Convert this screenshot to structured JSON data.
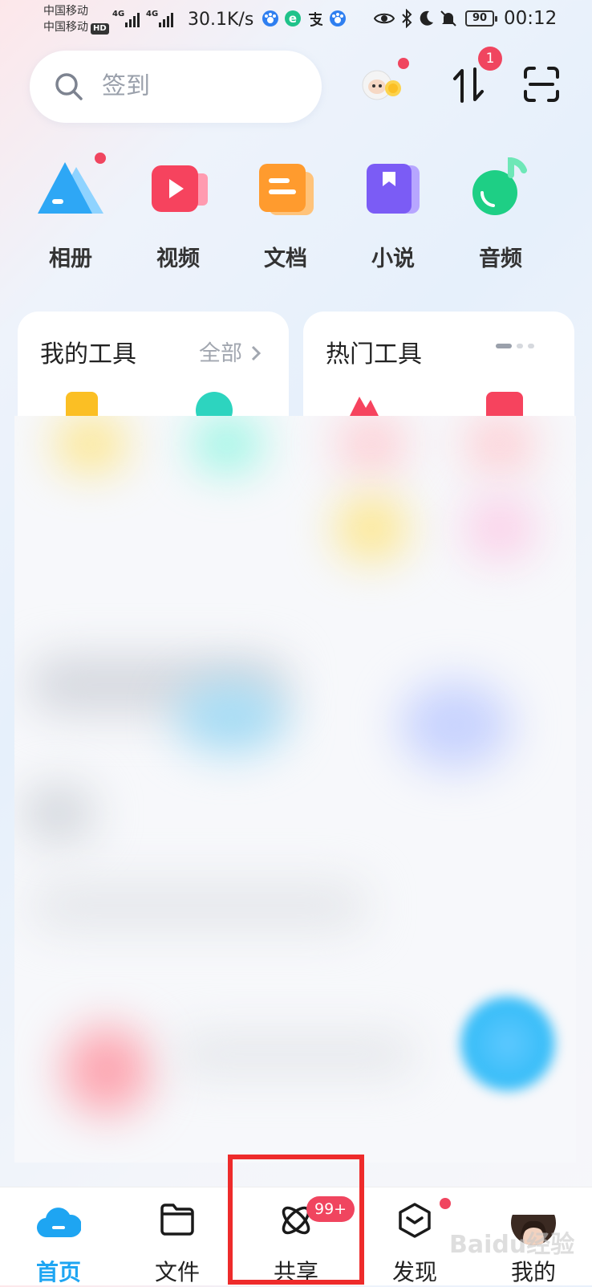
{
  "status_bar": {
    "carrier1": "中国移动",
    "carrier2": "中国移动",
    "hd_label": "HD",
    "network1": "4G",
    "network2": "4G",
    "speed": "30.1K/s",
    "battery": "90",
    "time": "00:12",
    "icons": [
      "baidu-paw-icon",
      "browser-e-icon",
      "alipay-icon",
      "baidu-paw-icon",
      "eye-icon",
      "bluetooth-icon",
      "moon-icon",
      "bell-muted-icon"
    ]
  },
  "header": {
    "search_placeholder": "签到",
    "transfer_badge": "1"
  },
  "categories": [
    {
      "label": "相册",
      "icon": "album-icon"
    },
    {
      "label": "视频",
      "icon": "video-icon"
    },
    {
      "label": "文档",
      "icon": "document-icon"
    },
    {
      "label": "小说",
      "icon": "novel-icon"
    },
    {
      "label": "音频",
      "icon": "audio-icon"
    }
  ],
  "my_tools": {
    "title": "我的工具",
    "more": "全部"
  },
  "hot_tools": {
    "title": "热门工具"
  },
  "bottom_nav": [
    {
      "label": "首页",
      "icon": "cloud-icon",
      "active": true
    },
    {
      "label": "文件",
      "icon": "folder-icon",
      "active": false
    },
    {
      "label": "共享",
      "icon": "share-orbit-icon",
      "badge": "99+",
      "active": false
    },
    {
      "label": "发现",
      "icon": "discover-cube-icon",
      "active": false
    },
    {
      "label": "我的",
      "icon": "avatar",
      "active": false
    }
  ],
  "watermark": "Baidu经验",
  "colors": {
    "accent": "#1ea5f2",
    "badge": "#f0455f",
    "highlight": "#ee2b2b"
  }
}
